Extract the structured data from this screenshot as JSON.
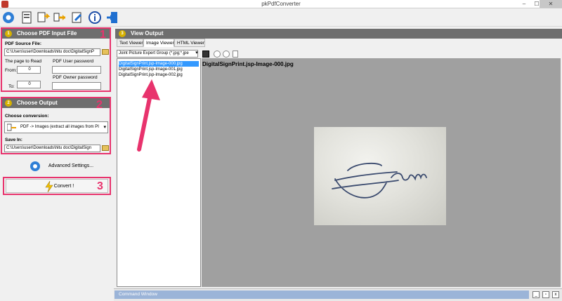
{
  "window": {
    "title": "pkPdfConverter",
    "min": "–",
    "max": "☐",
    "close": "✕"
  },
  "section1": {
    "number": "1",
    "title": "Choose PDF Input File",
    "source_label": "PDF Source File:",
    "source_value": "C:\\Users\\user\\Downloads\\hitu doc\\DigitalSignP",
    "page_label": "The page to Read",
    "from_label": "From:",
    "from_value": "0",
    "to_label": "To:",
    "to_value": "0",
    "user_pw_label": "PDF User password",
    "owner_pw_label": "PDF Owner  password",
    "badge": "1"
  },
  "section2": {
    "number": "2",
    "title": "Choose Output",
    "conversion_label": "Choose conversion:",
    "conversion_value": "PDF -> Images (extract all images from PI",
    "save_label": "Save In:",
    "save_value": "C:\\Users\\user\\Downloads\\hitu doc\\DigitalSign",
    "badge": "2"
  },
  "advanced_label": "Advanced Settings...",
  "convert_label": "Convert !",
  "badge3": "3",
  "view": {
    "number": "3",
    "title": "View Output",
    "tabs": [
      "Text Viewer",
      "Image Viewer",
      "HTML Viewer"
    ],
    "filter_value": "Joint Picture Expert Group (*.jpg;*.jpe",
    "files": [
      "DigitalSignPrint.jsp-Image-000.jpg",
      "DigitalSignPrint.jsp-Image-001.jpg",
      "DigitalSignPrint.jsp-Image-002.jpg"
    ],
    "image_title": "DigitalSignPrint.jsp-Image-000.jpg"
  },
  "command_window": {
    "title": "Command Window"
  },
  "colors": {
    "accent": "#e8336d",
    "header": "#6e6e6e",
    "selection": "#3399ff"
  }
}
